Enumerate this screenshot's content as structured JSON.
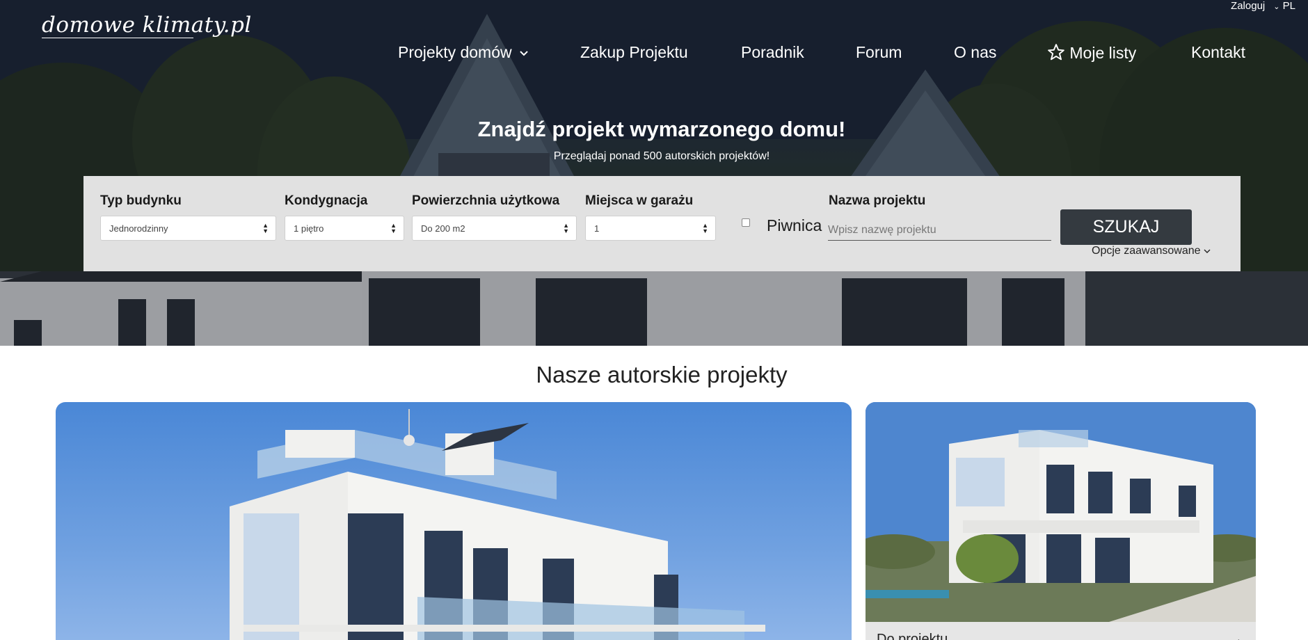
{
  "brand": {
    "logo_text": "domowe klimaty.pl"
  },
  "topbar": {
    "login": "Zaloguj",
    "language": "PL"
  },
  "nav": {
    "items": [
      {
        "label": "Projekty domów",
        "has_dropdown": true
      },
      {
        "label": "Zakup Projektu"
      },
      {
        "label": "Poradnik"
      },
      {
        "label": "Forum"
      },
      {
        "label": "O nas"
      },
      {
        "label": "Moje listy",
        "icon": "star-icon"
      },
      {
        "label": "Kontakt"
      }
    ]
  },
  "hero": {
    "title": "Znajdź projekt wymarzonego domu!",
    "subtitle": "Przeglądaj ponad 500 autorskich projektów!"
  },
  "search": {
    "building_type": {
      "label": "Typ budynku",
      "value": "Jednorodzinny"
    },
    "floors": {
      "label": "Kondygnacja",
      "value": "1 piętro"
    },
    "area": {
      "label": "Powierzchnia użytkowa",
      "value": "Do 200 m2"
    },
    "garage": {
      "label": "Miejsca w garażu",
      "value": "1"
    },
    "basement": {
      "label": "Piwnica",
      "checked": false
    },
    "project_name": {
      "label": "Nazwa projektu",
      "placeholder": "Wpisz nazwę projektu",
      "value": ""
    },
    "submit_label": "SZUKAJ",
    "advanced_label": "Opcje zaawansowane"
  },
  "projects": {
    "section_title": "Nasze autorskie projekty",
    "small_card_caption": "Do projektu",
    "small_card_arrow": "→"
  },
  "colors": {
    "search_panel_bg": "#e1e1e1",
    "button_bg": "#343a40",
    "hero_overlay": "#1c2434"
  }
}
